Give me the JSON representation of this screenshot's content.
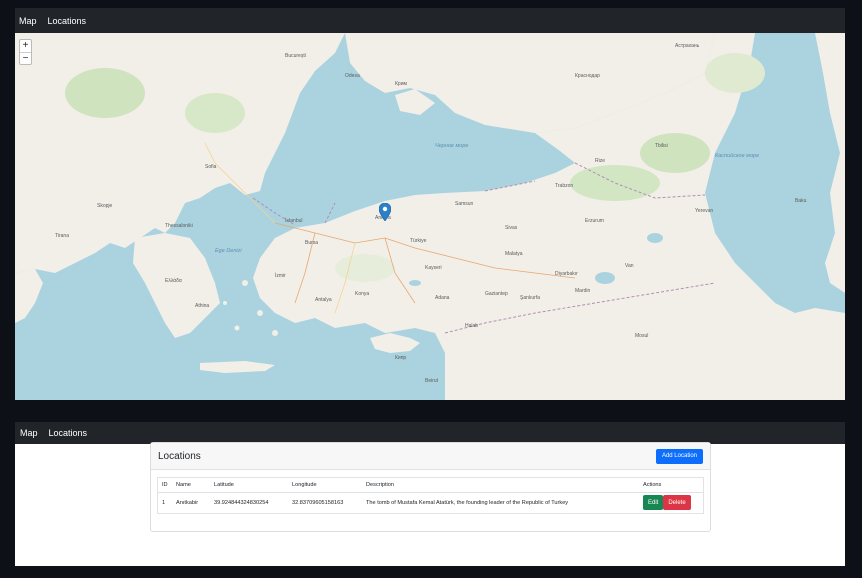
{
  "top_nav": {
    "map_label": "Map",
    "locations_label": "Locations"
  },
  "map": {
    "zoom_in": "+",
    "zoom_out": "−",
    "labels": [
      "Sofia",
      "Skopje",
      "Tirana",
      "Thessaloniki",
      "Athina",
      "İstanbul",
      "Bursa",
      "İzmir",
      "Ankara",
      "Konya",
      "Kayseri",
      "Samsun",
      "Trabzon",
      "Tbilisi",
      "Baku",
      "Yerevan",
      "Adana",
      "Gaziantep",
      "Antalya",
      "Ελλάδα",
      "Türkiye",
      "Кипр",
      "București",
      "Odesa",
      "Крим",
      "Краснодар",
      "Астрахань",
      "Sivas",
      "Malatya",
      "Erzurum",
      "Van",
      "Diyarbakır",
      "Şanlıurfa",
      "Mardin",
      "Halab",
      "Mosul",
      "Beirut",
      "Rize"
    ],
    "sea_labels": [
      "Черное море",
      "Каспийское море",
      "Ege Denizi"
    ],
    "marker": "map-marker-icon"
  },
  "bottom_nav": {
    "map_label": "Map",
    "locations_label": "Locations"
  },
  "locations": {
    "title": "Locations",
    "add_button": "Add Location",
    "columns": [
      "ID",
      "Name",
      "Latitude",
      "Longitude",
      "Description",
      "Actions"
    ],
    "rows": [
      {
        "id": "1",
        "name": "Anıtkabir",
        "latitude": "39.924844324830254",
        "longitude": "32.83709605158163",
        "description": "The tomb of Mustafa Kemal Atatürk, the founding leader of the Republic of Turkey",
        "edit": "Edit",
        "delete": "Delete"
      }
    ]
  },
  "colors": {
    "navbar": "#212529",
    "primary": "#0d6efd",
    "success": "#198754",
    "danger": "#dc3545",
    "marker": "#2a81cb",
    "sea": "#aad3df",
    "land": "#f2efe9"
  }
}
